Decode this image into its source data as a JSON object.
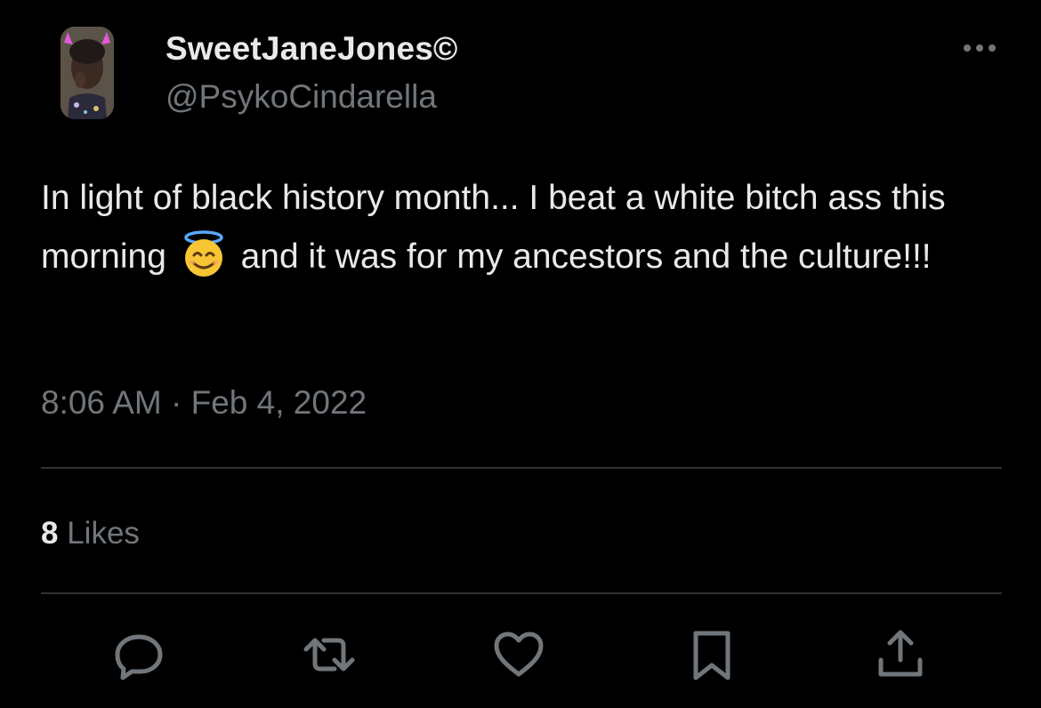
{
  "author": {
    "display_name": "SweetJaneJones©",
    "handle": "@PsykoCindarella"
  },
  "tweet": {
    "text_part1": "In light of black history month... I beat a white bitch ass this morning",
    "emoji_icon": "smiling-face-with-halo-icon",
    "text_part2": "and it was for my ancestors and the culture!!!",
    "timestamp": "8:06 AM · Feb 4, 2022"
  },
  "stats": {
    "likes_count": "8",
    "likes_label": "Likes"
  },
  "actions": [
    {
      "name": "reply",
      "icon": "reply-icon"
    },
    {
      "name": "retweet",
      "icon": "retweet-icon"
    },
    {
      "name": "like",
      "icon": "heart-icon"
    },
    {
      "name": "bookmark",
      "icon": "bookmark-icon"
    },
    {
      "name": "share",
      "icon": "share-icon"
    }
  ],
  "colors": {
    "background": "#000000",
    "primary_text": "#e7e9ea",
    "secondary_text": "#71767b",
    "divider": "#2f3336"
  }
}
